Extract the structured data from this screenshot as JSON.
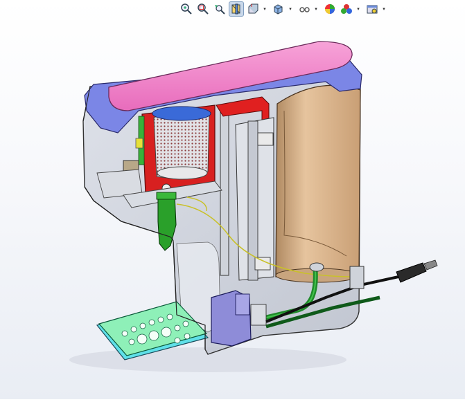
{
  "window": {
    "title": ""
  },
  "toolbar": {
    "buttons": [
      {
        "name": "zoom-to-fit-button",
        "icon": "zoom-to-fit-icon",
        "dropdown": false,
        "active": false
      },
      {
        "name": "zoom-to-area-button",
        "icon": "zoom-to-area-icon",
        "dropdown": false,
        "active": false
      },
      {
        "name": "previous-view-button",
        "icon": "previous-view-icon",
        "dropdown": false,
        "active": false
      },
      {
        "name": "section-view-button",
        "icon": "section-view-icon",
        "dropdown": false,
        "active": true
      },
      {
        "name": "view-orientation-button",
        "icon": "view-orientation-icon",
        "dropdown": true,
        "active": false
      },
      {
        "name": "display-style-button",
        "icon": "display-style-icon",
        "dropdown": true,
        "active": false
      },
      {
        "name": "hide-show-items-button",
        "icon": "hide-show-items-icon",
        "dropdown": true,
        "active": false
      },
      {
        "name": "edit-appearance-button",
        "icon": "edit-appearance-icon",
        "dropdown": false,
        "active": false
      },
      {
        "name": "apply-scene-button",
        "icon": "apply-scene-icon",
        "dropdown": true,
        "active": false
      },
      {
        "name": "view-settings-button",
        "icon": "view-settings-icon",
        "dropdown": true,
        "active": false
      }
    ]
  },
  "model": {
    "name": "",
    "colors": {
      "lid": "#f07fc6",
      "lid_rim": "#7b86e6",
      "housing": "#c8ccd6",
      "filter_holder": "#d82020",
      "filter_basket": "#d9d9dc",
      "water_tank": "#d7b48e",
      "drip_tray": "#8ef0b8",
      "drip_tray_edge": "#5fe0e8",
      "nozzle": "#2aa02a",
      "hose": "#1f8a2a",
      "pump_block": "#8e8cd8",
      "heater_block": "#d8d8d8",
      "accent_yellow": "#e6e038",
      "cable": "#111111",
      "plug": "#2a2a2a"
    }
  }
}
